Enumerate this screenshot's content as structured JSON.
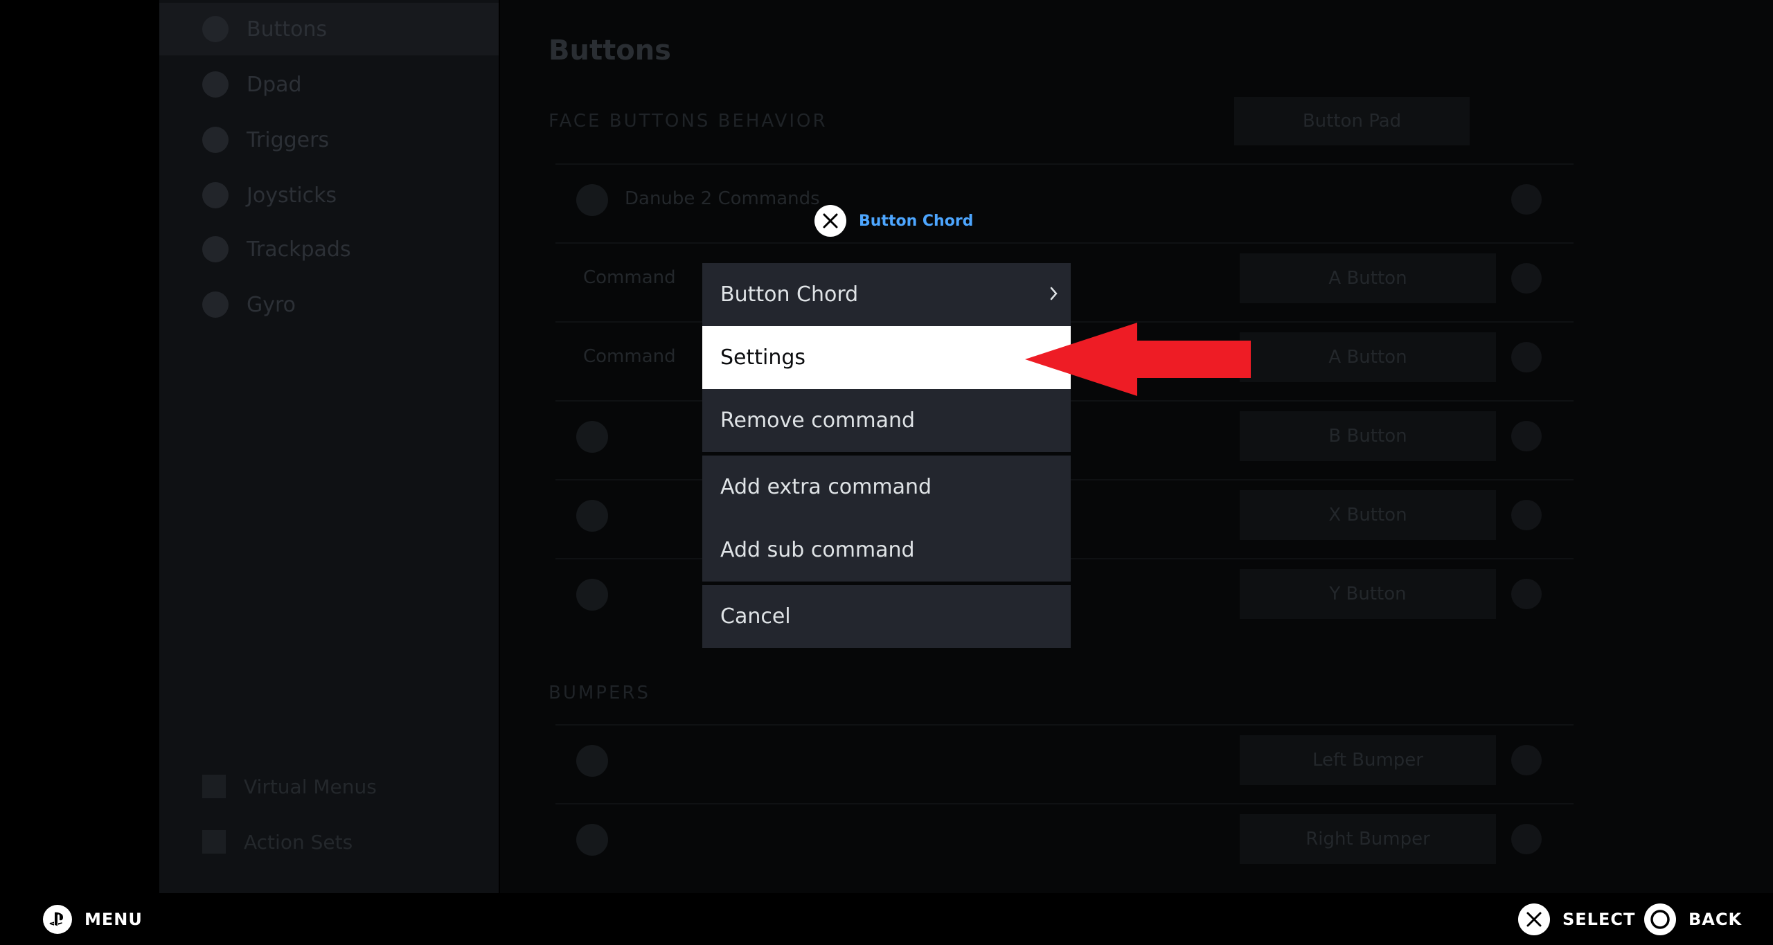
{
  "background": {
    "sidebar": {
      "items": [
        {
          "label": "Buttons"
        },
        {
          "label": "Dpad"
        },
        {
          "label": "Triggers"
        },
        {
          "label": "Joysticks"
        },
        {
          "label": "Trackpads"
        },
        {
          "label": "Gyro"
        }
      ],
      "bottom_items": [
        {
          "label": "Virtual Menus"
        },
        {
          "label": "Action Sets"
        }
      ]
    },
    "main": {
      "title": "Buttons",
      "section1": "FACE BUTTONS BEHAVIOR",
      "dropdown_value": "Button Pad",
      "rows": [
        {
          "label": "Danube 2 Commands",
          "button": ""
        },
        {
          "label": "Command",
          "button": "A Button"
        },
        {
          "label": "Command",
          "button": "A Button"
        },
        {
          "label": "",
          "button": "B Button"
        },
        {
          "label": "",
          "button": "X Button"
        },
        {
          "label": "",
          "button": "Y Button"
        }
      ],
      "section2": "BUMPERS",
      "bumper_rows": [
        {
          "button": "Left Bumper"
        },
        {
          "button": "Right Bumper"
        }
      ]
    }
  },
  "menu": {
    "header_title": "Button Chord",
    "groups": [
      [
        {
          "label": "Button Chord",
          "has_submenu": true
        },
        {
          "label": "Settings",
          "selected": true
        },
        {
          "label": "Remove command"
        }
      ],
      [
        {
          "label": "Add extra command"
        },
        {
          "label": "Add sub command"
        }
      ],
      [
        {
          "label": "Cancel"
        }
      ]
    ]
  },
  "annotation": {
    "arrow_color": "#ee1c25"
  },
  "footer": {
    "menu_label": "MENU",
    "select_label": "SELECT",
    "back_label": "BACK"
  },
  "colors": {
    "accent": "#4da6ff",
    "menu_bg": "#23262e",
    "selected_bg": "#ffffff"
  }
}
